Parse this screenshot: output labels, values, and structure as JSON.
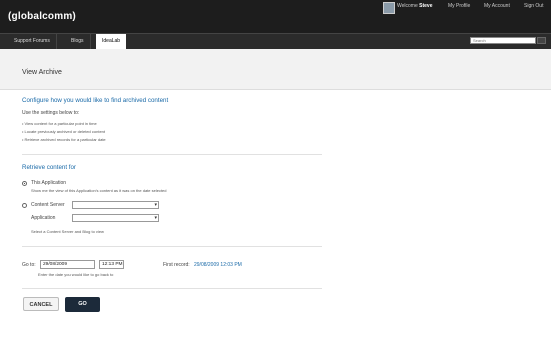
{
  "header": {
    "logo": "(globalcomm)",
    "welcome_prefix": "Welcome",
    "user_name": "Steve",
    "links": [
      "My Profile",
      "My Account",
      "Sign Out"
    ]
  },
  "nav": {
    "tabs": [
      "Support Forums",
      "Blogs",
      "IdeaLab"
    ],
    "active_tab": "IdeaLab",
    "search_placeholder": "Search"
  },
  "page": {
    "title": "View Archive"
  },
  "intro": {
    "heading": "Configure how you would like to find archived content",
    "subheading": "Use the settings below to:",
    "bullets": [
      "• View content for a particular point in time",
      "• Locate previously archived or deleted content",
      "• Retrieve archived records for a particular date"
    ]
  },
  "retrieve": {
    "heading": "Retrieve content for",
    "option_app": "This Application",
    "option_app_desc": "Show me the view of this Application's content as it was on the date selected",
    "option_server": "Content Server",
    "application_label": "Application",
    "server_hint": "Select a Content Server and Blog to view"
  },
  "goto": {
    "label": "Go to:",
    "date": "29/08/2009",
    "time": "12:13 PM",
    "hint": "Enter the date you would like to go back to",
    "first_record_label": "First record:",
    "first_record_value": "29/08/2009 12:03 PM"
  },
  "actions": {
    "cancel": "CANCEL",
    "go": "GO"
  }
}
